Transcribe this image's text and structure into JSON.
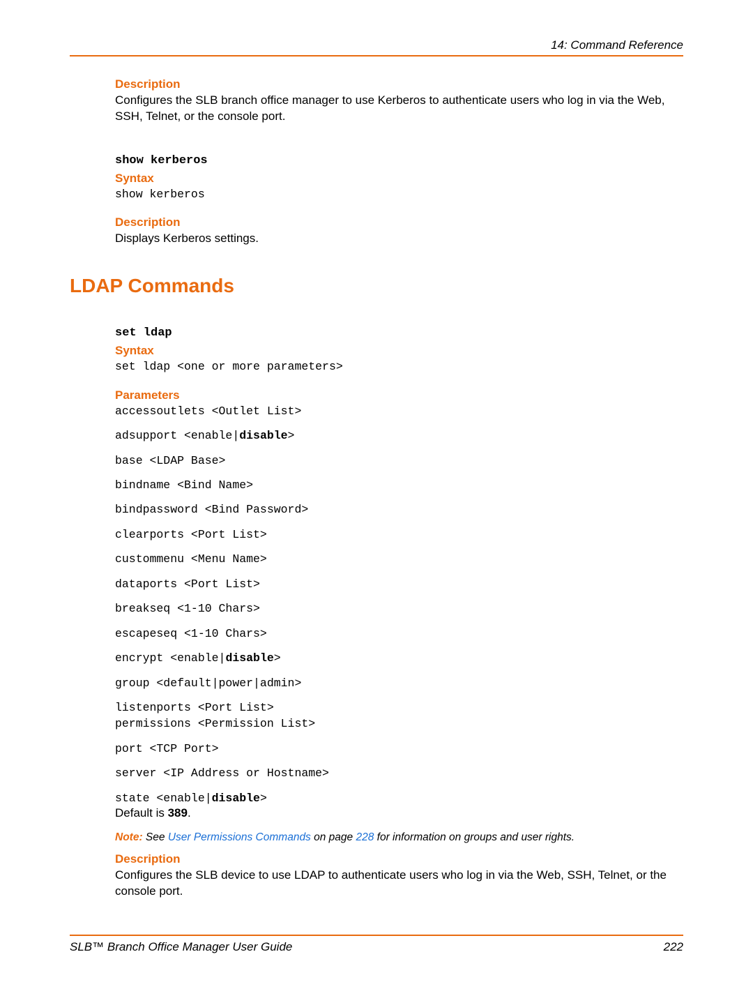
{
  "header": {
    "right": "14: Command Reference"
  },
  "sec1": {
    "desc_label": "Description",
    "desc_text": "Configures the SLB branch office manager to use Kerberos to authenticate users who log in via the Web, SSH, Telnet, or the console port."
  },
  "cmd_show_kerberos": {
    "name": "show kerberos",
    "syntax_label": "Syntax",
    "syntax_text": "show kerberos",
    "desc_label": "Description",
    "desc_text": "Displays Kerberos settings."
  },
  "ldap_heading": "LDAP Commands",
  "cmd_set_ldap": {
    "name": "set ldap",
    "syntax_label": "Syntax",
    "syntax_text": "set ldap <one or more parameters>",
    "params_label": "Parameters",
    "params": {
      "p0": "accessoutlets <Outlet List>",
      "p1a": "adsupport <enable|",
      "p1b": "disable",
      "p1c": ">",
      "p2": "base <LDAP Base>",
      "p3": "bindname <Bind Name>",
      "p4": "bindpassword <Bind Password>",
      "p5": "clearports <Port List>",
      "p6": "custommenu <Menu Name>",
      "p7": "dataports <Port List>",
      "p8": "breakseq <1-10 Chars>",
      "p9": "escapeseq <1-10 Chars>",
      "p10a": "encrypt <enable|",
      "p10b": "disable",
      "p10c": ">",
      "p11": "group <default|power|admin>",
      "p12": "listenports <Port List>",
      "p13": "permissions <Permission List>",
      "p14": "port <TCP Port>",
      "p15": "server <IP Address or Hostname>",
      "p16a": "state <enable|",
      "p16b": "disable",
      "p16c": ">",
      "default_prefix": "Default is ",
      "default_value": "389",
      "default_suffix": "."
    },
    "note": {
      "label": "Note:",
      "pre": " See ",
      "link": "User Permissions Commands",
      "mid": " on page ",
      "page": "228",
      "post": " for information on groups and user rights."
    },
    "desc_label": "Description",
    "desc_text": "Configures the SLB device to use LDAP to authenticate users who log in via the Web, SSH, Telnet, or the console port."
  },
  "footer": {
    "left": "SLB™ Branch Office Manager User Guide",
    "right": "222"
  }
}
